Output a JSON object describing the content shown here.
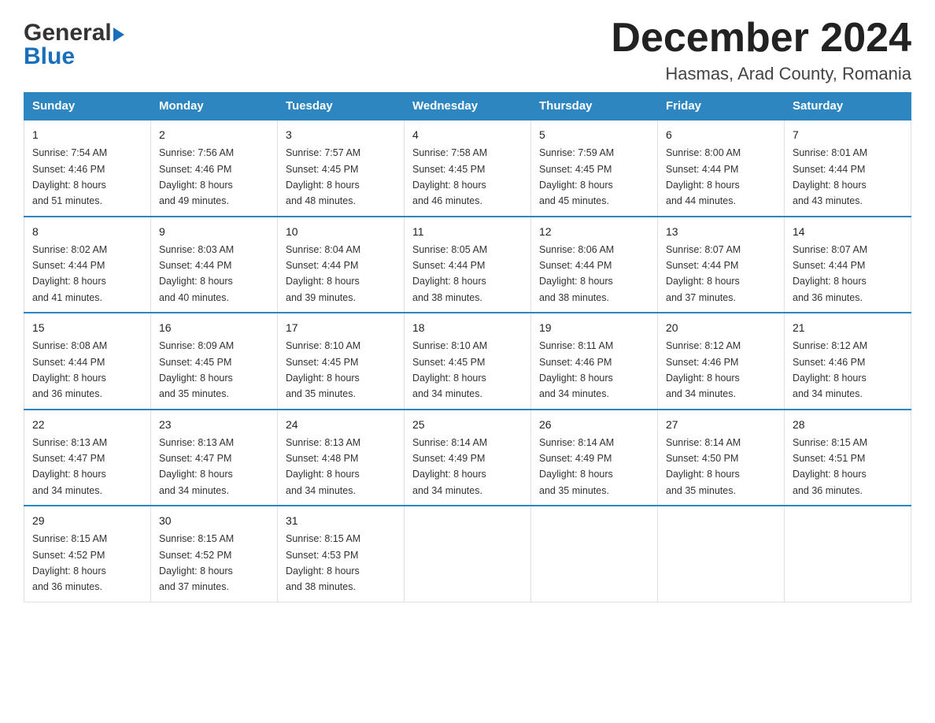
{
  "header": {
    "logo_general": "General",
    "logo_blue": "Blue",
    "month_title": "December 2024",
    "location": "Hasmas, Arad County, Romania"
  },
  "days_of_week": [
    "Sunday",
    "Monday",
    "Tuesday",
    "Wednesday",
    "Thursday",
    "Friday",
    "Saturday"
  ],
  "weeks": [
    [
      {
        "day": "1",
        "sunrise": "7:54 AM",
        "sunset": "4:46 PM",
        "daylight_hours": "8",
        "daylight_minutes": "51"
      },
      {
        "day": "2",
        "sunrise": "7:56 AM",
        "sunset": "4:46 PM",
        "daylight_hours": "8",
        "daylight_minutes": "49"
      },
      {
        "day": "3",
        "sunrise": "7:57 AM",
        "sunset": "4:45 PM",
        "daylight_hours": "8",
        "daylight_minutes": "48"
      },
      {
        "day": "4",
        "sunrise": "7:58 AM",
        "sunset": "4:45 PM",
        "daylight_hours": "8",
        "daylight_minutes": "46"
      },
      {
        "day": "5",
        "sunrise": "7:59 AM",
        "sunset": "4:45 PM",
        "daylight_hours": "8",
        "daylight_minutes": "45"
      },
      {
        "day": "6",
        "sunrise": "8:00 AM",
        "sunset": "4:44 PM",
        "daylight_hours": "8",
        "daylight_minutes": "44"
      },
      {
        "day": "7",
        "sunrise": "8:01 AM",
        "sunset": "4:44 PM",
        "daylight_hours": "8",
        "daylight_minutes": "43"
      }
    ],
    [
      {
        "day": "8",
        "sunrise": "8:02 AM",
        "sunset": "4:44 PM",
        "daylight_hours": "8",
        "daylight_minutes": "41"
      },
      {
        "day": "9",
        "sunrise": "8:03 AM",
        "sunset": "4:44 PM",
        "daylight_hours": "8",
        "daylight_minutes": "40"
      },
      {
        "day": "10",
        "sunrise": "8:04 AM",
        "sunset": "4:44 PM",
        "daylight_hours": "8",
        "daylight_minutes": "39"
      },
      {
        "day": "11",
        "sunrise": "8:05 AM",
        "sunset": "4:44 PM",
        "daylight_hours": "8",
        "daylight_minutes": "38"
      },
      {
        "day": "12",
        "sunrise": "8:06 AM",
        "sunset": "4:44 PM",
        "daylight_hours": "8",
        "daylight_minutes": "38"
      },
      {
        "day": "13",
        "sunrise": "8:07 AM",
        "sunset": "4:44 PM",
        "daylight_hours": "8",
        "daylight_minutes": "37"
      },
      {
        "day": "14",
        "sunrise": "8:07 AM",
        "sunset": "4:44 PM",
        "daylight_hours": "8",
        "daylight_minutes": "36"
      }
    ],
    [
      {
        "day": "15",
        "sunrise": "8:08 AM",
        "sunset": "4:44 PM",
        "daylight_hours": "8",
        "daylight_minutes": "36"
      },
      {
        "day": "16",
        "sunrise": "8:09 AM",
        "sunset": "4:45 PM",
        "daylight_hours": "8",
        "daylight_minutes": "35"
      },
      {
        "day": "17",
        "sunrise": "8:10 AM",
        "sunset": "4:45 PM",
        "daylight_hours": "8",
        "daylight_minutes": "35"
      },
      {
        "day": "18",
        "sunrise": "8:10 AM",
        "sunset": "4:45 PM",
        "daylight_hours": "8",
        "daylight_minutes": "34"
      },
      {
        "day": "19",
        "sunrise": "8:11 AM",
        "sunset": "4:46 PM",
        "daylight_hours": "8",
        "daylight_minutes": "34"
      },
      {
        "day": "20",
        "sunrise": "8:12 AM",
        "sunset": "4:46 PM",
        "daylight_hours": "8",
        "daylight_minutes": "34"
      },
      {
        "day": "21",
        "sunrise": "8:12 AM",
        "sunset": "4:46 PM",
        "daylight_hours": "8",
        "daylight_minutes": "34"
      }
    ],
    [
      {
        "day": "22",
        "sunrise": "8:13 AM",
        "sunset": "4:47 PM",
        "daylight_hours": "8",
        "daylight_minutes": "34"
      },
      {
        "day": "23",
        "sunrise": "8:13 AM",
        "sunset": "4:47 PM",
        "daylight_hours": "8",
        "daylight_minutes": "34"
      },
      {
        "day": "24",
        "sunrise": "8:13 AM",
        "sunset": "4:48 PM",
        "daylight_hours": "8",
        "daylight_minutes": "34"
      },
      {
        "day": "25",
        "sunrise": "8:14 AM",
        "sunset": "4:49 PM",
        "daylight_hours": "8",
        "daylight_minutes": "34"
      },
      {
        "day": "26",
        "sunrise": "8:14 AM",
        "sunset": "4:49 PM",
        "daylight_hours": "8",
        "daylight_minutes": "35"
      },
      {
        "day": "27",
        "sunrise": "8:14 AM",
        "sunset": "4:50 PM",
        "daylight_hours": "8",
        "daylight_minutes": "35"
      },
      {
        "day": "28",
        "sunrise": "8:15 AM",
        "sunset": "4:51 PM",
        "daylight_hours": "8",
        "daylight_minutes": "36"
      }
    ],
    [
      {
        "day": "29",
        "sunrise": "8:15 AM",
        "sunset": "4:52 PM",
        "daylight_hours": "8",
        "daylight_minutes": "36"
      },
      {
        "day": "30",
        "sunrise": "8:15 AM",
        "sunset": "4:52 PM",
        "daylight_hours": "8",
        "daylight_minutes": "37"
      },
      {
        "day": "31",
        "sunrise": "8:15 AM",
        "sunset": "4:53 PM",
        "daylight_hours": "8",
        "daylight_minutes": "38"
      },
      null,
      null,
      null,
      null
    ]
  ]
}
